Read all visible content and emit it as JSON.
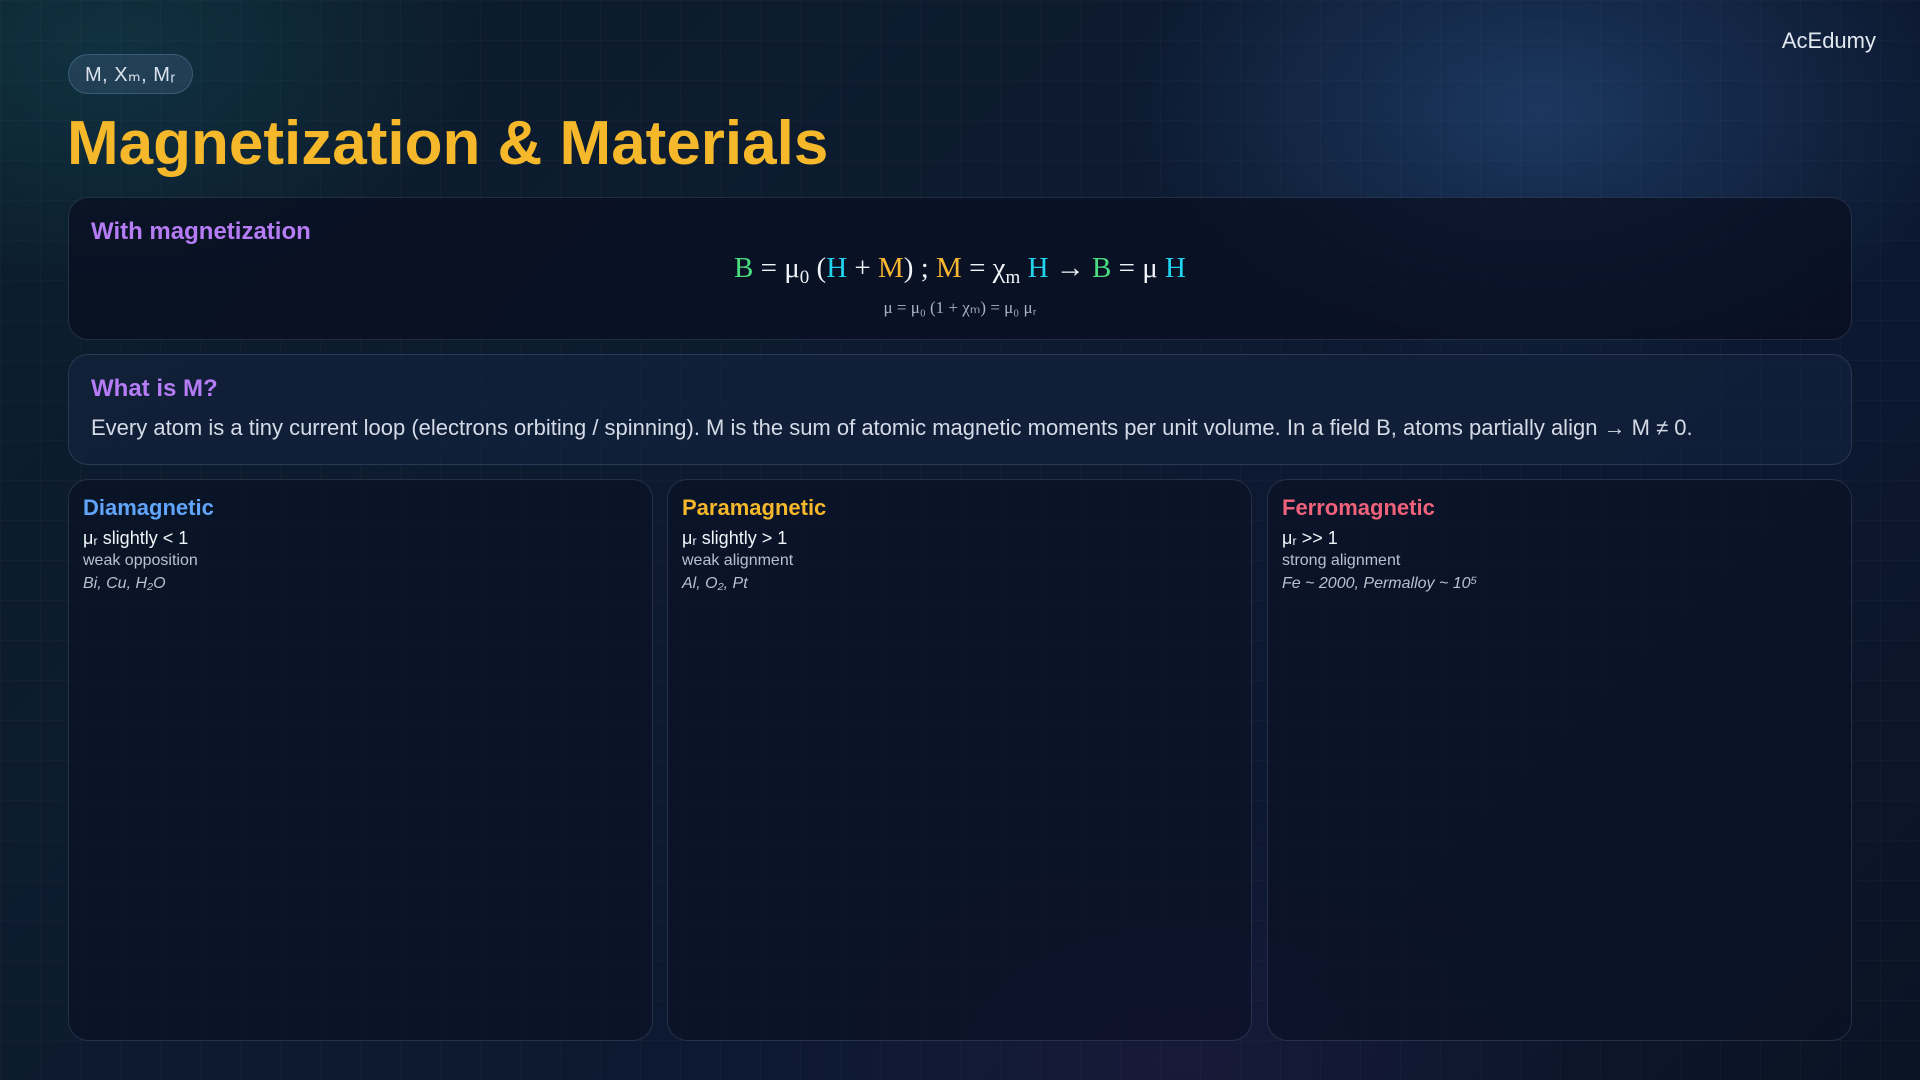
{
  "brand": "AcEdumy",
  "pill": "M, Xₘ, Mᵣ",
  "title": "Magnetization & Materials",
  "formula_card": {
    "heading": "With magnetization",
    "main": {
      "b1": "B",
      "t1": " = μ",
      "s1": "0",
      "t2": " (",
      "h1": "H",
      "t3": " + ",
      "m1": "M",
      "t4": ") ; ",
      "m2": "M",
      "t5": " = χ",
      "s2": "m",
      "t6": " ",
      "h2": "H",
      "t7": " → ",
      "b2": "B",
      "t8": " = μ ",
      "h3": "H"
    },
    "sub": "μ = μ₀ (1 + χₘ) = μ₀ μᵣ"
  },
  "what_card": {
    "heading": "What is M?",
    "body": "Every atom is a tiny current loop (electrons orbiting / spinning). M is the sum of atomic magnetic moments per unit volume. In a field B, atoms partially align → M ≠ 0."
  },
  "materials": {
    "dia": {
      "title": "Diamagnetic",
      "mu": "μᵣ slightly < 1",
      "desc": "weak opposition",
      "ex": "Bi, Cu, H₂O",
      "color": "#60a5fa"
    },
    "para": {
      "title": "Paramagnetic",
      "mu": "μᵣ slightly > 1",
      "desc": "weak alignment",
      "ex": "Al, O₂, Pt",
      "color": "#f5b82a"
    },
    "ferro": {
      "title": "Ferromagnetic",
      "mu": "μᵣ >> 1",
      "desc": "strong alignment",
      "ex": "Fe ~ 2000, Permalloy ~ 10⁵",
      "color": "#f0627a"
    }
  },
  "colors": {
    "title": "#f5b82a",
    "heading": "#b57cf5",
    "B": "#4ade80",
    "H": "#22d3ee",
    "M": "#f7b731"
  }
}
